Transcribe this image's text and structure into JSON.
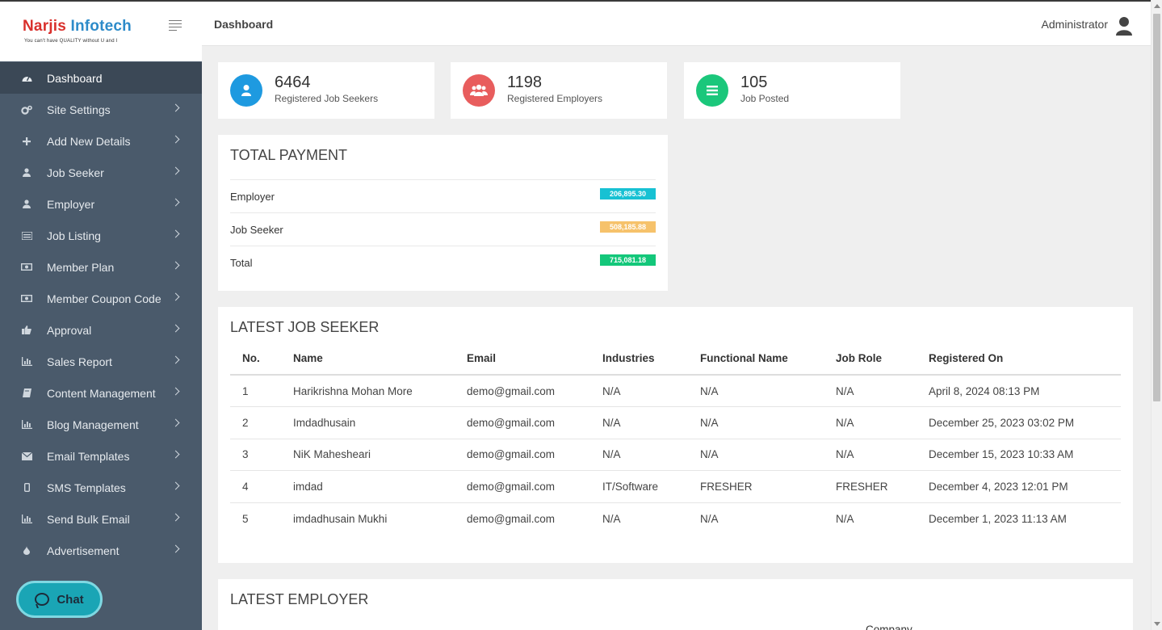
{
  "brand": {
    "name_part1": "Narjis ",
    "name_part2": "Infotech",
    "tagline": "You can't have QUALITY without U and I"
  },
  "sidebar": {
    "items": [
      {
        "label": "Dashboard",
        "icon": "dashboard-icon",
        "active": true
      },
      {
        "label": "Site Settings",
        "icon": "gears-icon"
      },
      {
        "label": "Add New Details",
        "icon": "plus-icon"
      },
      {
        "label": "Job Seeker",
        "icon": "user-icon"
      },
      {
        "label": "Employer",
        "icon": "user-icon"
      },
      {
        "label": "Job Listing",
        "icon": "list-icon"
      },
      {
        "label": "Member Plan",
        "icon": "money-icon"
      },
      {
        "label": "Member Coupon Code",
        "icon": "money-icon"
      },
      {
        "label": "Approval",
        "icon": "thumbs-up-icon"
      },
      {
        "label": "Sales Report",
        "icon": "bar-chart-icon"
      },
      {
        "label": "Content Management",
        "icon": "book-icon"
      },
      {
        "label": "Blog Management",
        "icon": "bar-chart-icon"
      },
      {
        "label": "Email Templates",
        "icon": "envelope-icon"
      },
      {
        "label": "SMS Templates",
        "icon": "mobile-icon"
      },
      {
        "label": "Send Bulk Email",
        "icon": "bar-chart-icon"
      },
      {
        "label": "Advertisement",
        "icon": "tint-icon"
      }
    ]
  },
  "chat": {
    "label": "Chat"
  },
  "header": {
    "title": "Dashboard",
    "user": "Administrator"
  },
  "stats": [
    {
      "value": "6464",
      "label": "Registered Job Seekers",
      "color": "#1e9ae0"
    },
    {
      "value": "1198",
      "label": "Registered Employers",
      "color": "#e85d5d"
    },
    {
      "value": "105",
      "label": "Job Posted",
      "color": "#1bc77b"
    }
  ],
  "payment": {
    "title": "TOTAL PAYMENT",
    "rows": [
      {
        "label": "Employer",
        "amount": "206,895.30",
        "color": "#17c1d3"
      },
      {
        "label": "Job Seeker",
        "amount": "508,185.88",
        "color": "#f6c26b"
      },
      {
        "label": "Total",
        "amount": "715,081.18",
        "color": "#13c77a"
      }
    ]
  },
  "latest_job_seeker": {
    "title": "LATEST JOB SEEKER",
    "columns": [
      "No.",
      "Name",
      "Email",
      "Industries",
      "Functional Name",
      "Job Role",
      "Registered On"
    ],
    "rows": [
      [
        "1",
        "Harikrishna Mohan More",
        "demo@gmail.com",
        "N/A",
        "N/A",
        "N/A",
        "April 8, 2024 08:13 PM"
      ],
      [
        "2",
        "Imdadhusain",
        "demo@gmail.com",
        "N/A",
        "N/A",
        "N/A",
        "December 25, 2023 03:02 PM"
      ],
      [
        "3",
        "NiK Mahesheari",
        "demo@gmail.com",
        "N/A",
        "N/A",
        "N/A",
        "December 15, 2023 10:33 AM"
      ],
      [
        "4",
        "imdad",
        "demo@gmail.com",
        "IT/Software",
        "FRESHER",
        "FRESHER",
        "December 4, 2023 12:01 PM"
      ],
      [
        "5",
        "imdadhusain Mukhi",
        "demo@gmail.com",
        "N/A",
        "N/A",
        "N/A",
        "December 1, 2023 11:13 AM"
      ]
    ]
  },
  "latest_employer": {
    "title": "LATEST EMPLOYER",
    "partial_column": "Company"
  }
}
